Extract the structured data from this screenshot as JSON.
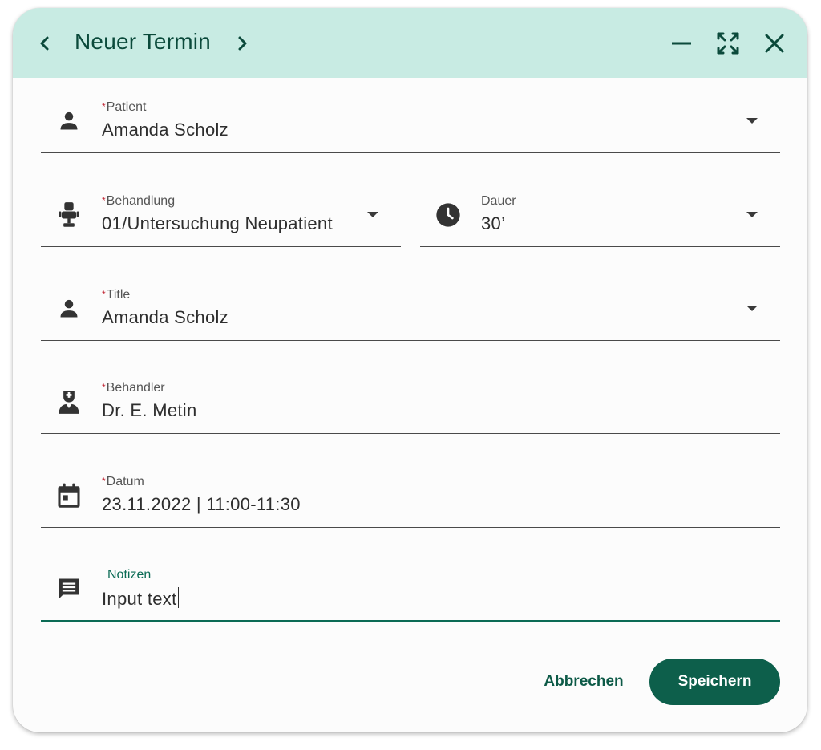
{
  "header": {
    "title": "Neuer Termin",
    "icons": [
      "chevron-left-icon",
      "chevron-right-icon",
      "minimize-icon",
      "expand-icon",
      "close-icon"
    ]
  },
  "fields": {
    "patient": {
      "required_mark": "*",
      "label": "Patient",
      "value": "Amanda Scholz",
      "icon": "person-icon"
    },
    "behandlung": {
      "required_mark": "*",
      "label": "Behandlung",
      "value": "01/Untersuchung Neupatient",
      "icon": "dental-chair-icon"
    },
    "dauer": {
      "label": "Dauer",
      "value": "30’",
      "icon": "clock-icon"
    },
    "title": {
      "required_mark": "*",
      "label": "Title",
      "value": "Amanda Scholz",
      "icon": "person-icon"
    },
    "behandler": {
      "required_mark": "*",
      "label": "Behandler",
      "value": "Dr. E. Metin",
      "icon": "doctor-icon"
    },
    "datum": {
      "required_mark": "*",
      "label": "Datum",
      "value": "23.11.2022 | 11:00-11:30",
      "icon": "calendar-icon"
    },
    "notizen": {
      "label": "Notizen",
      "value": "Input text",
      "icon": "comment-icon"
    }
  },
  "actions": {
    "cancel_label": "Abbrechen",
    "save_label": "Speichern"
  },
  "colors": {
    "header_bg": "#c8ebe3",
    "accent": "#0d5f4b",
    "required": "#c0212f"
  }
}
